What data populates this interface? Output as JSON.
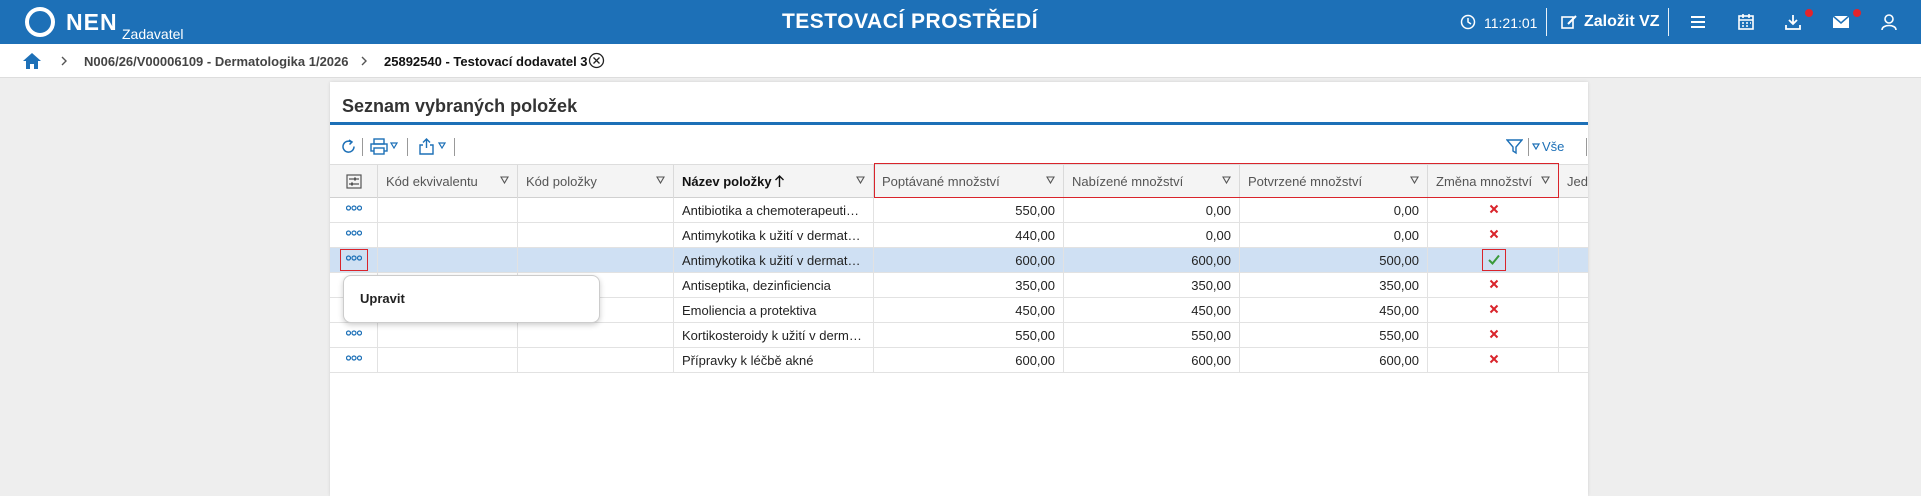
{
  "header": {
    "brand": "NEN",
    "brand_sub": "Zadavatel",
    "env_title": "TESTOVACÍ PROSTŘEDÍ",
    "clock": "11:21:01",
    "new_vz": "Založit VZ",
    "accent": "#1d70b7"
  },
  "breadcrumb": {
    "item1": "N006/26/V00006109 - Dermatologika 1/2026",
    "item2": "25892540 - Testovací dodavatel 3"
  },
  "panel": {
    "title": "Seznam vybraných položek",
    "filter_all": "Vše"
  },
  "table": {
    "columns": [
      "Kód ekvivalentu",
      "Kód položky",
      "Název položky",
      "Poptávané množství",
      "Nabízené množství",
      "Potvrzené množství",
      "Změna množství",
      "Jed"
    ],
    "rows": [
      {
        "name": "Antibiotika a chemoterapeutik…",
        "requested": "550,00",
        "offered": "0,00",
        "confirmed": "0,00",
        "change": "no"
      },
      {
        "name": "Antimykotika k užití v dermato…",
        "requested": "440,00",
        "offered": "0,00",
        "confirmed": "0,00",
        "change": "no"
      },
      {
        "name": "Antimykotika k užití v dermato…",
        "requested": "600,00",
        "offered": "600,00",
        "confirmed": "500,00",
        "change": "yes"
      },
      {
        "name": "Antiseptika, dezinficiencia",
        "requested": "350,00",
        "offered": "350,00",
        "confirmed": "350,00",
        "change": "no"
      },
      {
        "name": "Emoliencia a protektiva",
        "requested": "450,00",
        "offered": "450,00",
        "confirmed": "450,00",
        "change": "no"
      },
      {
        "name": "Kortikosteroidy k užití v derm…",
        "requested": "550,00",
        "offered": "550,00",
        "confirmed": "550,00",
        "change": "no"
      },
      {
        "name": "Přípravky k léčbě akné",
        "requested": "600,00",
        "offered": "600,00",
        "confirmed": "600,00",
        "change": "no"
      }
    ]
  },
  "context_menu": {
    "item": "Upravit"
  },
  "colors": {
    "check": "#3a9a3a",
    "cross": "#d9242b",
    "selected_row": "#cfe0f3",
    "highlight": "#d9242b"
  }
}
